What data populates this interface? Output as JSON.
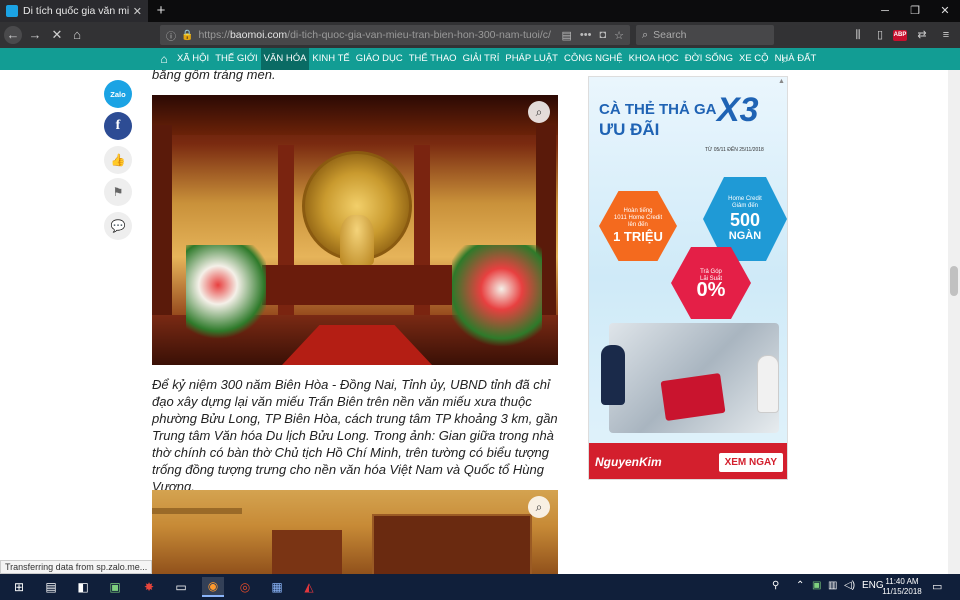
{
  "browser": {
    "tab_title": "Di tích quốc gia văn miếu Trấn",
    "tab_close": "✕",
    "new_tab": "+",
    "url_prefix": "https://",
    "url_domain": "baomoi.com",
    "url_path": "/di-tich-quoc-gia-van-mieu-tran-bien-hon-300-nam-tuoi/c/",
    "search_placeholder": "Search",
    "abp_label": "ABP",
    "status_text": "Transferring data from sp.zalo.me..."
  },
  "site_nav": {
    "categories": [
      "XÃ HỘI",
      "THẾ GIỚI",
      "VĂN HÓA",
      "KINH TẾ",
      "GIÁO DỤC",
      "THỂ THAO",
      "GIẢI TRÍ",
      "PHÁP LUẬT",
      "CÔNG NGHỆ",
      "KHOA HỌC",
      "ĐỜI SỐNG",
      "XE CỘ",
      "NHÀ ĐẤT"
    ],
    "active_category": "VĂN HÓA",
    "colors": {
      "bar": "#129d94",
      "active": "#0a6b64"
    }
  },
  "social": {
    "zalo_label": "Zalo",
    "facebook_label": "f"
  },
  "article": {
    "prev_text": "bằng gốm tráng men.",
    "caption": "Để kỷ niệm 300 năm Biên Hòa - Đồng Nai, Tỉnh ủy, UBND tỉnh đã chỉ đạo xây dựng lại văn miếu Trấn Biên trên nền văn miếu xưa thuộc phường Bửu Long, TP Biên Hòa, cách trung tâm TP khoảng 3 km, gần Trung tâm Văn hóa Du lịch Bửu Long. Trong ảnh: Gian giữa trong nhà thờ chính có bàn thờ Chủ tịch Hồ Chí Minh, trên tường có biểu tượng trống đồng tượng trưng cho nền văn hóa Việt Nam và Quốc tổ Hùng Vương."
  },
  "ad": {
    "headline_1": "CÀ THẺ THẢ GA",
    "headline_2": "ƯU ĐÃI",
    "multiplier": "X3",
    "dates": "TỪ 05/11 ĐẾN 25/11/2018",
    "offer_a_small": "Hoàn tiếng\n1011 Home Credit\nlên đến",
    "offer_a_big": "1 TRIỆU",
    "offer_b_small": "Home Credit\nGiảm đến",
    "offer_b_big": "500",
    "offer_b_sub": "NGÀN",
    "offer_c_small": "Trả Góp\nLãi Suất",
    "offer_c_big": "0%",
    "brand": "NguyenKim",
    "cta": "XEM NGAY",
    "colors": {
      "blue": "#1f63b4",
      "orange": "#f46a1e",
      "cyan": "#1f9ad6",
      "red": "#e41f47",
      "footer": "#d31f2d"
    }
  },
  "taskbar": {
    "language": "ENG",
    "time": "11:40 AM",
    "date": "11/15/2018"
  }
}
